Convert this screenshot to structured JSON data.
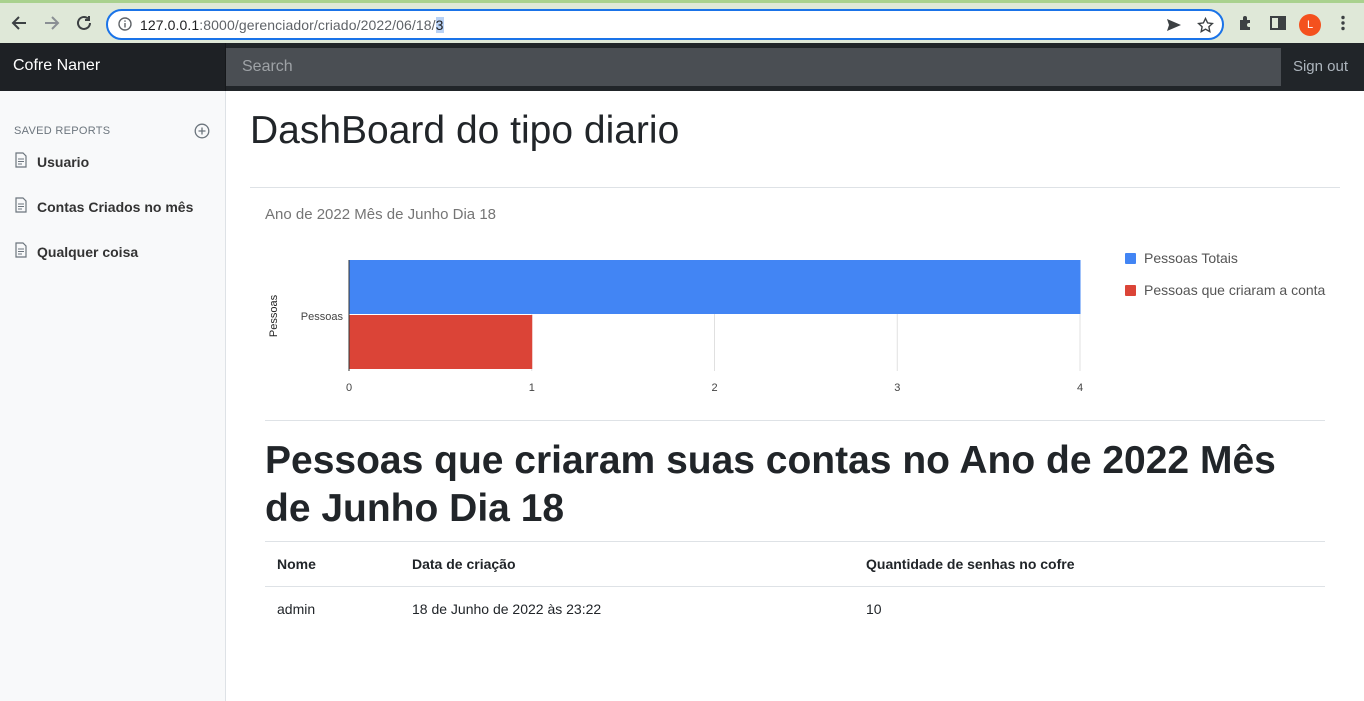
{
  "browser": {
    "url_host": "127.0.0.1",
    "url_rest": ":8000/gerenciador/criado/2022/06/18/",
    "url_selected": "3",
    "avatar_letter": "L",
    "accent": "#1a73e8"
  },
  "navbar": {
    "brand": "Cofre Naner",
    "search_placeholder": "Search",
    "signout": "Sign out"
  },
  "sidebar": {
    "heading": "SAVED REPORTS",
    "items": [
      {
        "label": "Usuario",
        "icon": "file-text-icon"
      },
      {
        "label": "Contas Criados no mês",
        "icon": "file-text-icon"
      },
      {
        "label": "Qualquer coisa",
        "icon": "file-text-icon"
      }
    ]
  },
  "main": {
    "title": "DashBoard do tipo diario",
    "section_title": "Pessoas que criaram suas contas no Ano de 2022 Mês de Junho Dia 18"
  },
  "chart_data": {
    "type": "bar",
    "orientation": "horizontal",
    "title": "Ano de 2022 Mês de Junho Dia 18",
    "ylabel": "Pessoas",
    "categories": [
      "Pessoas"
    ],
    "series": [
      {
        "name": "Pessoas Totais",
        "values": [
          4
        ],
        "color": "#4285f4"
      },
      {
        "name": "Pessoas que criaram a conta",
        "values": [
          1
        ],
        "color": "#db4437"
      }
    ],
    "xlim": [
      0,
      4
    ],
    "xticks": [
      "0",
      "1",
      "2",
      "3",
      "4"
    ],
    "grid": true,
    "legend": "right"
  },
  "table": {
    "headers": [
      "Nome",
      "Data de criação",
      "Quantidade de senhas no cofre"
    ],
    "rows": [
      [
        "admin",
        "18 de Junho de 2022 às 23:22",
        "10"
      ]
    ]
  }
}
